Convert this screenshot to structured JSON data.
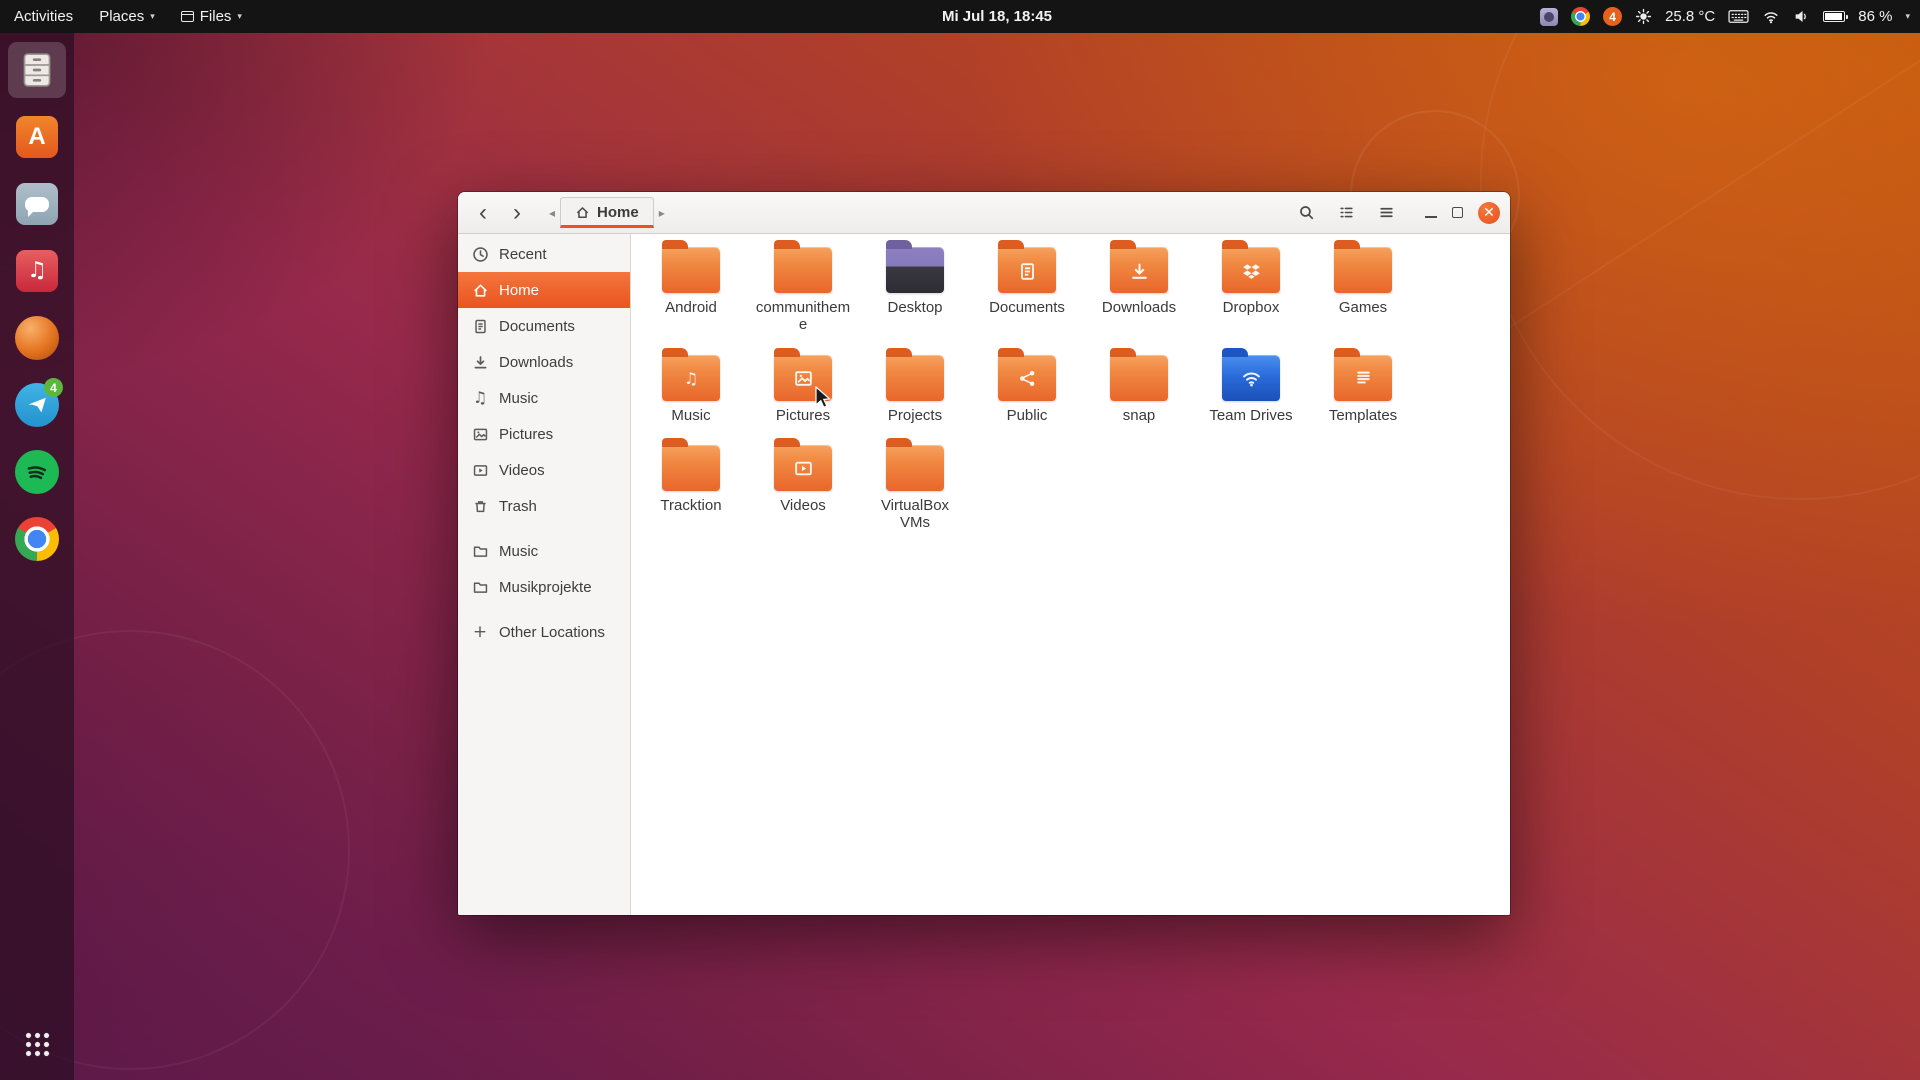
{
  "topbar": {
    "activities": "Activities",
    "places": "Places",
    "files_menu": "Files",
    "clock": "Mi Jul 18, 18:45",
    "notification_count": "4",
    "temperature": "25.8 °C",
    "battery_percent": "86 %"
  },
  "dock": {
    "items": [
      {
        "id": "files",
        "active": true
      },
      {
        "id": "ubuntu-software"
      },
      {
        "id": "chat"
      },
      {
        "id": "rhythmbox"
      },
      {
        "id": "orange-sphere"
      },
      {
        "id": "telegram",
        "badge": "4"
      },
      {
        "id": "spotify"
      },
      {
        "id": "chrome"
      }
    ]
  },
  "window": {
    "location": "Home",
    "sidebar": {
      "items": [
        {
          "label": "Recent",
          "icon": "clock"
        },
        {
          "label": "Home",
          "icon": "home",
          "selected": true
        },
        {
          "label": "Documents",
          "icon": "document"
        },
        {
          "label": "Downloads",
          "icon": "download"
        },
        {
          "label": "Music",
          "icon": "music"
        },
        {
          "label": "Pictures",
          "icon": "image"
        },
        {
          "label": "Videos",
          "icon": "video"
        },
        {
          "label": "Trash",
          "icon": "trash"
        },
        {
          "label": "Music",
          "icon": "folder",
          "gap_before": true
        },
        {
          "label": "Musikprojekte",
          "icon": "folder"
        },
        {
          "label": "Other Locations",
          "icon": "plus",
          "gap_before": true
        }
      ]
    },
    "files": [
      {
        "name": "Android",
        "type": "folder"
      },
      {
        "name": "communitheme",
        "type": "folder"
      },
      {
        "name": "Desktop",
        "type": "folder-dark"
      },
      {
        "name": "Documents",
        "type": "folder",
        "emblem": "document"
      },
      {
        "name": "Downloads",
        "type": "folder",
        "emblem": "download"
      },
      {
        "name": "Dropbox",
        "type": "folder",
        "emblem": "dropbox"
      },
      {
        "name": "Games",
        "type": "folder"
      },
      {
        "name": "Music",
        "type": "folder",
        "emblem": "music"
      },
      {
        "name": "Pictures",
        "type": "folder",
        "emblem": "image"
      },
      {
        "name": "Projects",
        "type": "folder"
      },
      {
        "name": "Public",
        "type": "folder",
        "emblem": "share"
      },
      {
        "name": "snap",
        "type": "folder"
      },
      {
        "name": "Team Drives",
        "type": "drive-network",
        "emblem": "network"
      },
      {
        "name": "Templates",
        "type": "folder",
        "emblem": "template"
      },
      {
        "name": "Tracktion",
        "type": "folder"
      },
      {
        "name": "Videos",
        "type": "folder",
        "emblem": "video"
      },
      {
        "name": "VirtualBox VMs",
        "type": "folder"
      }
    ]
  }
}
